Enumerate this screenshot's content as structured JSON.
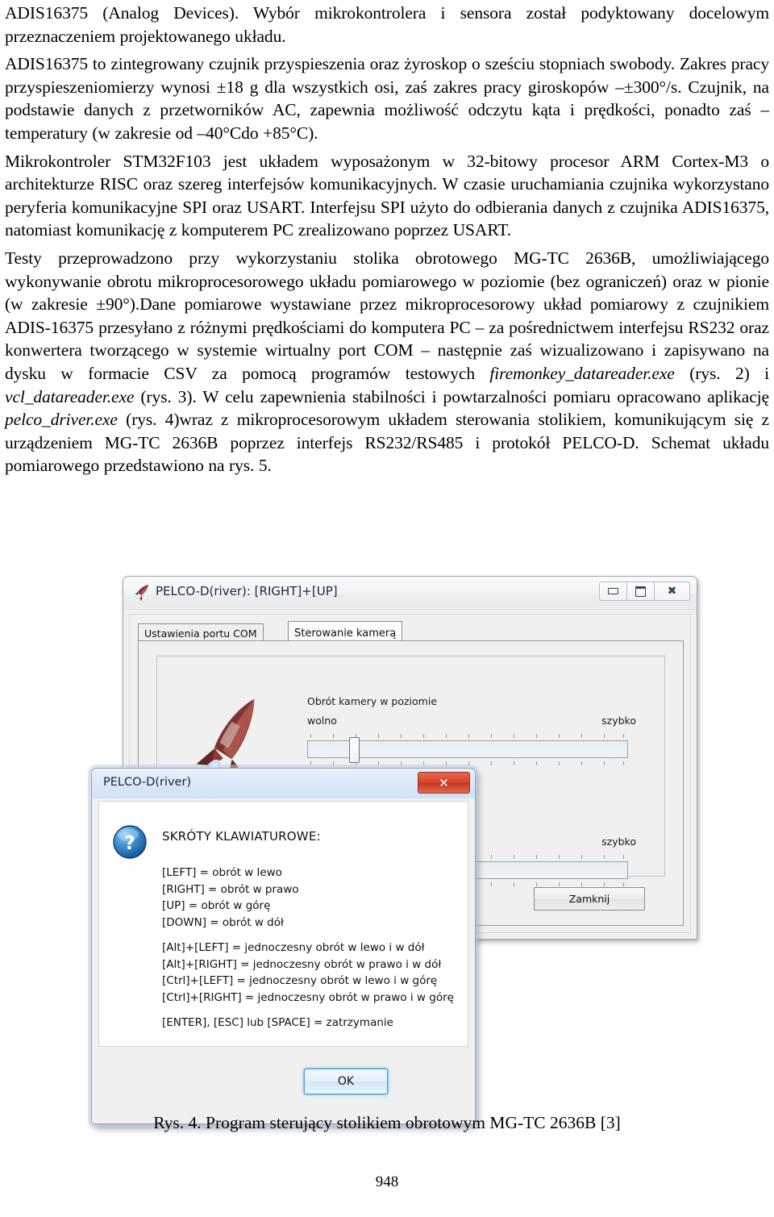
{
  "document": {
    "paragraphs": [
      "ADIS16375 (Analog Devices). Wybór mikrokontrolera i sensora został podyktowany docelowym przeznaczeniem projektowanego układu.",
      "ADIS16375 to zintegrowany czujnik przyspieszenia oraz żyroskop o sześciu stopniach swobody. Zakres pracy przyspieszeniomierzy wynosi ±18 g dla wszystkich osi, zaś zakres pracy giroskopów –±300°/s. Czujnik, na podstawie danych z przetworników AC, zapewnia możliwość odczytu kąta i prędkości, ponadto zaś – temperatury (w zakresie od –40°Cdo +85°C).",
      "Mikrokontroler STM32F103 jest układem wyposażonym w 32-bitowy procesor ARM Cortex-M3 o architekturze RISC oraz szereg interfejsów komunikacyjnych. W czasie uruchamiania czujnika wykorzystano peryferia komunikacyjne SPI oraz USART. Interfejsu SPI użyto do odbierania danych z czujnika ADIS16375, natomiast komunikację z komputerem PC zrealizowano poprzez USART."
    ],
    "paragraph4_parts": {
      "p1": "Testy przeprowadzono przy wykorzystaniu stolika obrotowego MG-TC 2636B, umożliwiającego wykonywanie obrotu mikroprocesorowego układu pomiarowego w poziomie (bez ograniczeń) oraz w pionie (w zakresie ±90°).Dane pomiarowe wystawiane przez mikroprocesorowy układ pomiarowy z czujnikiem ADIS-16375 przesyłano z różnymi prędkościami do komputera PC – za pośrednictwem interfejsu RS232 oraz konwertera tworzącego w systemie wirtualny port COM – następnie zaś wizualizowano i zapisywano na dysku w formacie CSV za pomocą programów testowych ",
      "i1": "firemonkey_datareader.exe",
      "p2": " (rys. 2) i ",
      "i2": "vcl_datareader.exe",
      "p3": " (rys. 3). W celu zapewnienia stabilności i powtarzalności pomiaru opracowano aplikację ",
      "i3": "pelco_driver.exe",
      "p4": " (rys. 4)wraz z mikroprocesorowym układem sterowania stolikiem, komunikującym się z urządzeniem MG-TC 2636B poprzez interfejs RS232/RS485 i protokół PELCO-D. Schemat układu pomiarowego przedstawiono na rys. 5."
    },
    "figure_caption": "Rys. 4. Program sterujący stolikiem obrotowym MG-TC 2636B [3]",
    "page_number": "948"
  },
  "screenshot": {
    "app_window": {
      "title": "PELCO-D(river): [RIGHT]+[UP]",
      "icon_name": "rocket-icon",
      "window_controls": {
        "minimize": "–",
        "maximize": "□",
        "close": "✕"
      },
      "tabs": [
        {
          "label": "Ustawienia portu COM",
          "active": false
        },
        {
          "label": "Sterowanie kamerą",
          "active": true
        }
      ],
      "sliders": [
        {
          "title": "Obrót kamery w poziomie",
          "left_label": "wolno",
          "right_label": "szybko",
          "value_percent": 14
        },
        {
          "title": "",
          "left_label": "",
          "right_label": "szybko",
          "value_percent": 0
        }
      ],
      "close_button_label": "Zamknij"
    },
    "dialog": {
      "title": "PELCO-D(river)",
      "close_label": "✕",
      "icon_name": "question-icon",
      "heading": "SKRÓTY KLAWIATUROWE:",
      "shortcuts_group_1": [
        "[LEFT] = obrót w lewo",
        "[RIGHT] = obrót w prawo",
        "[UP] = obrót w górę",
        "[DOWN] = obrót w dół"
      ],
      "shortcuts_group_2": [
        "[Alt]+[LEFT] = jednoczesny obrót w lewo i w dół",
        "[Alt]+[RIGHT] = jednoczesny obrót w prawo i w dół",
        "[Ctrl]+[LEFT] = jednoczesny obrót w lewo i w górę",
        "[Ctrl]+[RIGHT] = jednoczesny obrót w prawo i w górę"
      ],
      "shortcuts_group_3": [
        "[ENTER], [ESC] lub [SPACE] = zatrzymanie"
      ],
      "ok_button_label": "OK"
    }
  },
  "colors": {
    "dialog_titlebar": "#d9e8f7",
    "dialog_close_red": "#d9442b",
    "ok_focus_blue": "#4aa3d6",
    "window_chrome": "#f0f0f0",
    "rocket_red": "#8e3a34",
    "question_blue": "#1f6fb5"
  }
}
